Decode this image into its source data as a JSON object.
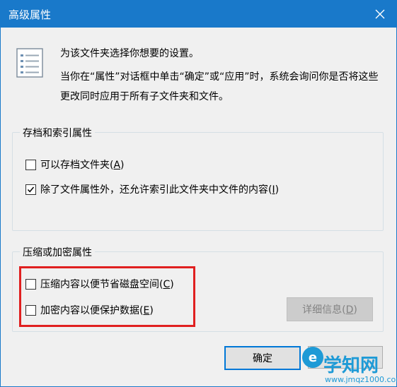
{
  "dialog": {
    "title": "高级属性"
  },
  "intro": {
    "line1": "为该文件夹选择你想要的设置。",
    "line2": "当你在“属性”对话框中单击“确定”或“应用”时，系统会询问你是否将这些更改同时应用于所有子文件夹和文件。"
  },
  "archive_group": {
    "title": "存档和索引属性",
    "items": [
      {
        "label_before": "可以存档文件夹(",
        "hotkey": "A",
        "label_after": ")",
        "checked": false
      },
      {
        "label_before": "除了文件属性外，还允许索引此文件夹中文件的内容(",
        "hotkey": "I",
        "label_after": ")",
        "checked": true
      }
    ]
  },
  "compress_group": {
    "title": "压缩或加密属性",
    "items": [
      {
        "label_before": "压缩内容以便节省磁盘空间(",
        "hotkey": "C",
        "label_after": ")",
        "checked": false
      },
      {
        "label_before": "加密内容以便保护数据(",
        "hotkey": "E",
        "label_after": ")",
        "checked": false
      }
    ],
    "details_button": {
      "label_before": "详细信息(",
      "hotkey": "D",
      "label_after": ")",
      "enabled": false
    }
  },
  "buttons": {
    "ok": "确定"
  },
  "watermark": {
    "main": "学知网",
    "sub": "www.jmqz1000.com"
  },
  "colors": {
    "titlebar": "#1979ca",
    "highlight": "#e02020",
    "watermark": "#1e9ad6"
  }
}
